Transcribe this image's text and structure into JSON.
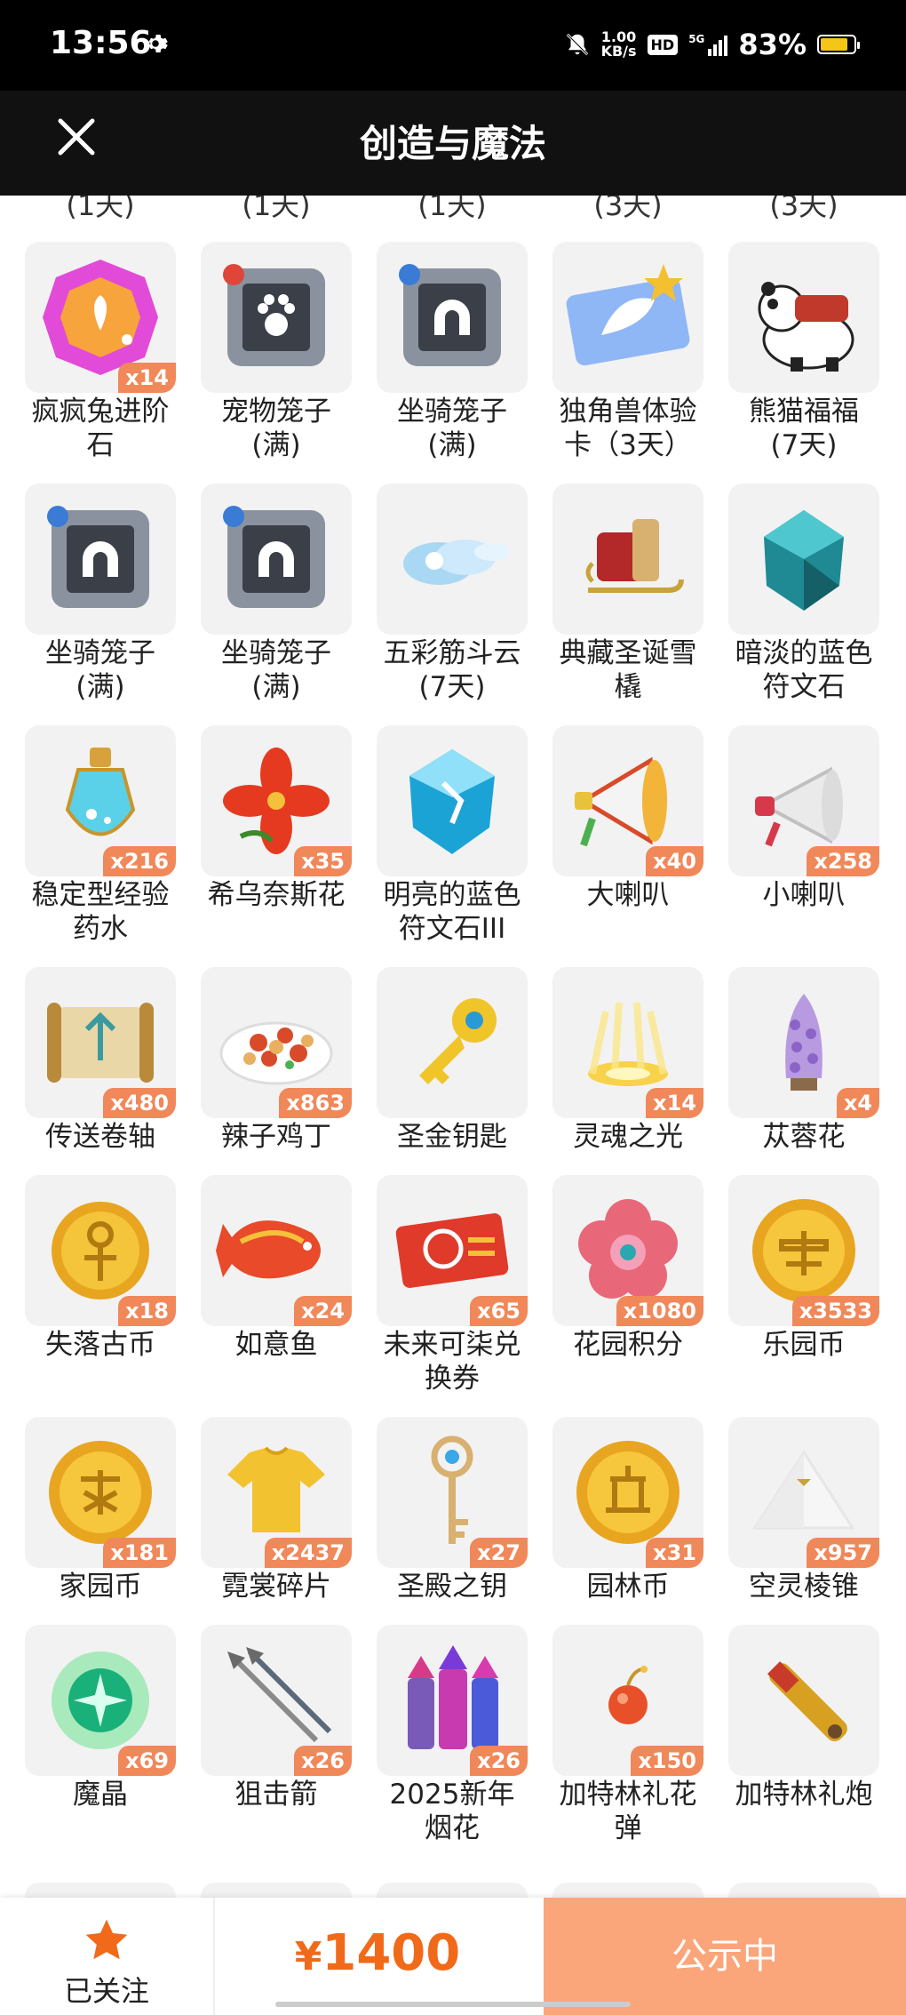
{
  "status_bar": {
    "time": "13:56",
    "speed_value": "1.00",
    "speed_unit": "KB/s",
    "hd": "HD",
    "network": "5G",
    "battery": "83%",
    "battery_level": 0.83
  },
  "header": {
    "title": "创造与魔法"
  },
  "partial_row": [
    "(1天)",
    "(1天)",
    "(1天)",
    "(3天)",
    "(3天)"
  ],
  "rows": [
    [
      {
        "name": "疯疯兔进阶\n石",
        "qty": "x14",
        "icon": "rabbit-gem-icon"
      },
      {
        "name": "宠物笼子\n(满)",
        "qty": "",
        "icon": "pet-cage-icon"
      },
      {
        "name": "坐骑笼子\n(满)",
        "qty": "",
        "icon": "mount-cage-icon"
      },
      {
        "name": "独角兽体验\n卡（3天）",
        "qty": "",
        "icon": "unicorn-card-icon"
      },
      {
        "name": "熊猫福福\n(7天)",
        "qty": "",
        "icon": "panda-icon"
      }
    ],
    [
      {
        "name": "坐骑笼子\n(满)",
        "qty": "",
        "icon": "mount-cage-icon"
      },
      {
        "name": "坐骑笼子\n(满)",
        "qty": "",
        "icon": "mount-cage-icon"
      },
      {
        "name": "五彩筋斗云\n(7天)",
        "qty": "",
        "icon": "cloud-icon"
      },
      {
        "name": "典藏圣诞雪\n橇",
        "qty": "",
        "icon": "sleigh-icon"
      },
      {
        "name": "暗淡的蓝色\n符文石",
        "qty": "",
        "icon": "dark-rune-stone-icon"
      }
    ],
    [
      {
        "name": "稳定型经验\n药水",
        "qty": "x216",
        "icon": "potion-icon"
      },
      {
        "name": "希乌奈斯花",
        "qty": "x35",
        "icon": "red-flower-icon"
      },
      {
        "name": "明亮的蓝色\n符文石III",
        "qty": "",
        "icon": "bright-rune-stone-icon"
      },
      {
        "name": "大喇叭",
        "qty": "x40",
        "icon": "big-horn-icon"
      },
      {
        "name": "小喇叭",
        "qty": "x258",
        "icon": "small-horn-icon"
      }
    ],
    [
      {
        "name": "传送卷轴",
        "qty": "x480",
        "icon": "scroll-icon"
      },
      {
        "name": "辣子鸡丁",
        "qty": "x863",
        "icon": "chicken-dish-icon"
      },
      {
        "name": "圣金钥匙",
        "qty": "",
        "icon": "gold-key-icon"
      },
      {
        "name": "灵魂之光",
        "qty": "x14",
        "icon": "soul-light-icon"
      },
      {
        "name": "苁蓉花",
        "qty": "x4",
        "icon": "purple-flower-icon"
      }
    ],
    [
      {
        "name": "失落古币",
        "qty": "x18",
        "icon": "ancient-coin-icon"
      },
      {
        "name": "如意鱼",
        "qty": "x24",
        "icon": "koi-fish-icon"
      },
      {
        "name": "未来可柒兑\n换券",
        "qty": "x65",
        "icon": "coupon-icon"
      },
      {
        "name": "花园积分",
        "qty": "x1080",
        "icon": "garden-points-icon"
      },
      {
        "name": "乐园币",
        "qty": "x3533",
        "icon": "park-coin-icon"
      }
    ],
    [
      {
        "name": "家园币",
        "qty": "x181",
        "icon": "home-coin-icon"
      },
      {
        "name": "霓裳碎片",
        "qty": "x2437",
        "icon": "shirt-fragment-icon"
      },
      {
        "name": "圣殿之钥",
        "qty": "x27",
        "icon": "temple-key-icon"
      },
      {
        "name": "园林币",
        "qty": "x31",
        "icon": "garden-coin-icon"
      },
      {
        "name": "空灵棱锥",
        "qty": "x957",
        "icon": "pyramid-icon"
      }
    ],
    [
      {
        "name": "魔晶",
        "qty": "x69",
        "icon": "magic-crystal-icon"
      },
      {
        "name": "狙击箭",
        "qty": "x26",
        "icon": "arrows-icon"
      },
      {
        "name": "2025新年\n烟花",
        "qty": "x26",
        "icon": "fireworks-icon"
      },
      {
        "name": "加特林礼花\n弹",
        "qty": "x150",
        "icon": "firework-shell-icon"
      },
      {
        "name": "加特林礼炮",
        "qty": "",
        "icon": "cannon-icon"
      }
    ]
  ],
  "bottom_bar": {
    "follow_label": "已关注",
    "currency": "¥",
    "price": "1400",
    "status_button": "公示中"
  },
  "colors": {
    "accent_orange": "#f06a1a",
    "qty_badge": "#f0885a",
    "status_button": "#fba57b",
    "header_bg": "#111111"
  }
}
